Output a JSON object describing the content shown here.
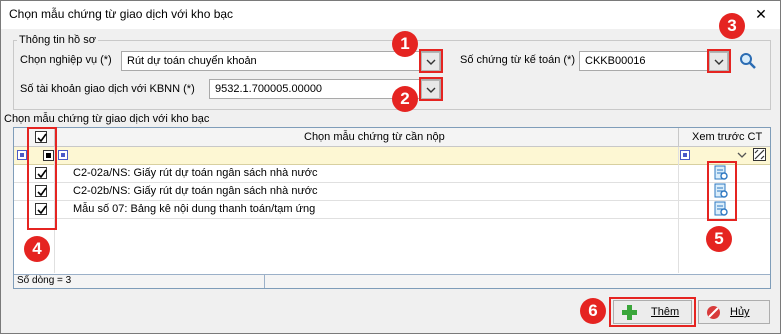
{
  "window": {
    "title": "Chọn mẫu chứng từ giao dịch với kho bạc",
    "close_icon": "close-icon"
  },
  "info_group": {
    "title": "Thông tin hồ sơ",
    "nghiep_vu_label": "Chọn nghiệp vụ (*)",
    "nghiep_vu_value": "Rút dự toán chuyển khoản",
    "so_chung_tu_label": "Số chứng từ kế toán (*)",
    "so_chung_tu_value": "CKKB00016",
    "tai_khoan_label": "Số tài khoản giao dịch với KBNN (*)",
    "tai_khoan_value": "9532.1.700005.00000"
  },
  "grid_group": {
    "title": "Chọn mẫu chứng từ giao dịch với kho bạc",
    "columns": {
      "select": "",
      "name": "Chọn mẫu chứng từ cần nộp",
      "preview": "Xem trước CT"
    },
    "rows": [
      {
        "checked": true,
        "name": "C2-02a/NS: Giấy rút dự toán ngân sách nhà nước"
      },
      {
        "checked": true,
        "name": "C2-02b/NS: Giấy rút dự toán ngân sách nhà nước"
      },
      {
        "checked": true,
        "name": "Mẫu số 07: Bảng kê nội dung thanh toán/tạm ứng"
      }
    ],
    "footer": "Số dòng = 3"
  },
  "buttons": {
    "them": "Thêm",
    "huy": "Hủy"
  },
  "annotations": [
    "1",
    "2",
    "3",
    "4",
    "5",
    "6"
  ],
  "colors": {
    "annotation_red": "#e52421",
    "filter_row": "#fdf7d3",
    "accent_blue": "#4a5ac8"
  }
}
